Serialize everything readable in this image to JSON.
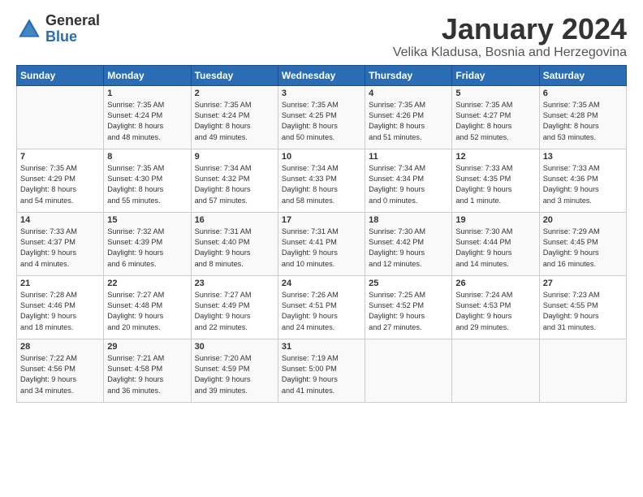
{
  "logo": {
    "general": "General",
    "blue": "Blue"
  },
  "title": "January 2024",
  "subtitle": "Velika Kladusa, Bosnia and Herzegovina",
  "days_of_week": [
    "Sunday",
    "Monday",
    "Tuesday",
    "Wednesday",
    "Thursday",
    "Friday",
    "Saturday"
  ],
  "weeks": [
    [
      {
        "day": "",
        "content": ""
      },
      {
        "day": "1",
        "content": "Sunrise: 7:35 AM\nSunset: 4:24 PM\nDaylight: 8 hours\nand 48 minutes."
      },
      {
        "day": "2",
        "content": "Sunrise: 7:35 AM\nSunset: 4:24 PM\nDaylight: 8 hours\nand 49 minutes."
      },
      {
        "day": "3",
        "content": "Sunrise: 7:35 AM\nSunset: 4:25 PM\nDaylight: 8 hours\nand 50 minutes."
      },
      {
        "day": "4",
        "content": "Sunrise: 7:35 AM\nSunset: 4:26 PM\nDaylight: 8 hours\nand 51 minutes."
      },
      {
        "day": "5",
        "content": "Sunrise: 7:35 AM\nSunset: 4:27 PM\nDaylight: 8 hours\nand 52 minutes."
      },
      {
        "day": "6",
        "content": "Sunrise: 7:35 AM\nSunset: 4:28 PM\nDaylight: 8 hours\nand 53 minutes."
      }
    ],
    [
      {
        "day": "7",
        "content": "Sunrise: 7:35 AM\nSunset: 4:29 PM\nDaylight: 8 hours\nand 54 minutes."
      },
      {
        "day": "8",
        "content": "Sunrise: 7:35 AM\nSunset: 4:30 PM\nDaylight: 8 hours\nand 55 minutes."
      },
      {
        "day": "9",
        "content": "Sunrise: 7:34 AM\nSunset: 4:32 PM\nDaylight: 8 hours\nand 57 minutes."
      },
      {
        "day": "10",
        "content": "Sunrise: 7:34 AM\nSunset: 4:33 PM\nDaylight: 8 hours\nand 58 minutes."
      },
      {
        "day": "11",
        "content": "Sunrise: 7:34 AM\nSunset: 4:34 PM\nDaylight: 9 hours\nand 0 minutes."
      },
      {
        "day": "12",
        "content": "Sunrise: 7:33 AM\nSunset: 4:35 PM\nDaylight: 9 hours\nand 1 minute."
      },
      {
        "day": "13",
        "content": "Sunrise: 7:33 AM\nSunset: 4:36 PM\nDaylight: 9 hours\nand 3 minutes."
      }
    ],
    [
      {
        "day": "14",
        "content": "Sunrise: 7:33 AM\nSunset: 4:37 PM\nDaylight: 9 hours\nand 4 minutes."
      },
      {
        "day": "15",
        "content": "Sunrise: 7:32 AM\nSunset: 4:39 PM\nDaylight: 9 hours\nand 6 minutes."
      },
      {
        "day": "16",
        "content": "Sunrise: 7:31 AM\nSunset: 4:40 PM\nDaylight: 9 hours\nand 8 minutes."
      },
      {
        "day": "17",
        "content": "Sunrise: 7:31 AM\nSunset: 4:41 PM\nDaylight: 9 hours\nand 10 minutes."
      },
      {
        "day": "18",
        "content": "Sunrise: 7:30 AM\nSunset: 4:42 PM\nDaylight: 9 hours\nand 12 minutes."
      },
      {
        "day": "19",
        "content": "Sunrise: 7:30 AM\nSunset: 4:44 PM\nDaylight: 9 hours\nand 14 minutes."
      },
      {
        "day": "20",
        "content": "Sunrise: 7:29 AM\nSunset: 4:45 PM\nDaylight: 9 hours\nand 16 minutes."
      }
    ],
    [
      {
        "day": "21",
        "content": "Sunrise: 7:28 AM\nSunset: 4:46 PM\nDaylight: 9 hours\nand 18 minutes."
      },
      {
        "day": "22",
        "content": "Sunrise: 7:27 AM\nSunset: 4:48 PM\nDaylight: 9 hours\nand 20 minutes."
      },
      {
        "day": "23",
        "content": "Sunrise: 7:27 AM\nSunset: 4:49 PM\nDaylight: 9 hours\nand 22 minutes."
      },
      {
        "day": "24",
        "content": "Sunrise: 7:26 AM\nSunset: 4:51 PM\nDaylight: 9 hours\nand 24 minutes."
      },
      {
        "day": "25",
        "content": "Sunrise: 7:25 AM\nSunset: 4:52 PM\nDaylight: 9 hours\nand 27 minutes."
      },
      {
        "day": "26",
        "content": "Sunrise: 7:24 AM\nSunset: 4:53 PM\nDaylight: 9 hours\nand 29 minutes."
      },
      {
        "day": "27",
        "content": "Sunrise: 7:23 AM\nSunset: 4:55 PM\nDaylight: 9 hours\nand 31 minutes."
      }
    ],
    [
      {
        "day": "28",
        "content": "Sunrise: 7:22 AM\nSunset: 4:56 PM\nDaylight: 9 hours\nand 34 minutes."
      },
      {
        "day": "29",
        "content": "Sunrise: 7:21 AM\nSunset: 4:58 PM\nDaylight: 9 hours\nand 36 minutes."
      },
      {
        "day": "30",
        "content": "Sunrise: 7:20 AM\nSunset: 4:59 PM\nDaylight: 9 hours\nand 39 minutes."
      },
      {
        "day": "31",
        "content": "Sunrise: 7:19 AM\nSunset: 5:00 PM\nDaylight: 9 hours\nand 41 minutes."
      },
      {
        "day": "",
        "content": ""
      },
      {
        "day": "",
        "content": ""
      },
      {
        "day": "",
        "content": ""
      }
    ]
  ]
}
